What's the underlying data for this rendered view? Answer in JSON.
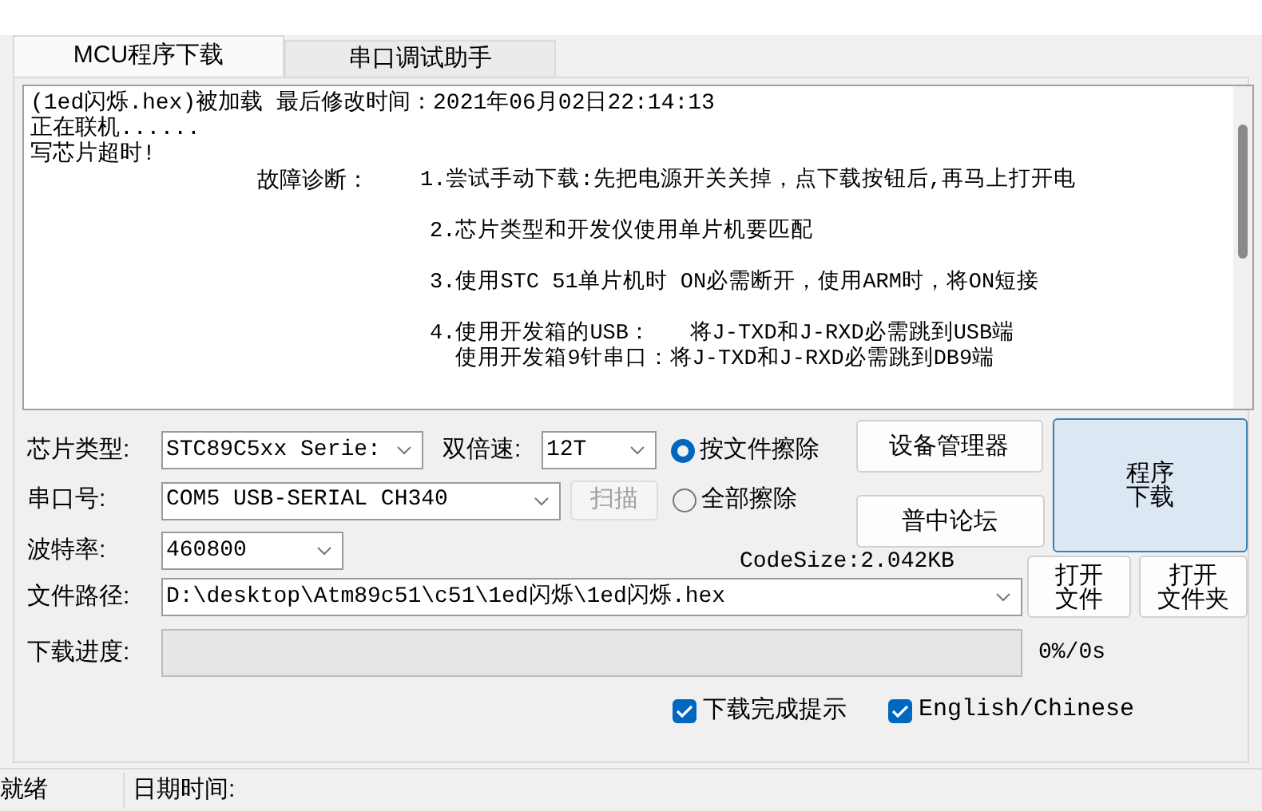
{
  "tabs": [
    {
      "label": "MCU程序下载",
      "selected": true
    },
    {
      "label": "串口调试助手",
      "selected": false
    }
  ],
  "log": {
    "lines": [
      "(1ed闪烁.hex)被加载 最后修改时间：2021年06月02日22:14:13",
      "正在联机......",
      "写芯片超时!"
    ],
    "diagnosis": {
      "label": "故障诊断：",
      "items": [
        [
          "1.尝试手动下载:先把电源开关关掉，点下载按钮后,再马上打开电"
        ],
        [
          "2.芯片类型和开发仪使用单片机要匹配"
        ],
        [
          "3.使用STC 51单片机时 ON必需断开，使用ARM时，将ON短接"
        ],
        [
          "4.使用开发箱的USB：   将J-TXD和J-RXD必需跳到USB端",
          "  使用开发箱9针串口：将J-TXD和J-RXD必需跳到DB9端"
        ]
      ]
    }
  },
  "chip_type": {
    "label": "芯片类型:",
    "value": "STC89C5xx Serie:"
  },
  "double_speed": {
    "label": "双倍速:",
    "value": "12T"
  },
  "erase_options": [
    {
      "label": "按文件擦除",
      "selected": true
    },
    {
      "label": "全部擦除",
      "selected": false
    }
  ],
  "device_manager_button": "设备管理器",
  "forum_button": "普中论坛",
  "download_button": [
    "程序",
    "下载"
  ],
  "port": {
    "label": "串口号:",
    "value": "COM5  USB-SERIAL CH340"
  },
  "scan_button": {
    "label": "扫描",
    "disabled": true
  },
  "baud": {
    "label": "波特率:",
    "value": "460800"
  },
  "code_size": "CodeSize:2.042KB",
  "file_path": {
    "label": "文件路径:",
    "value": "D:\\desktop\\Atm89c51\\c51\\1ed闪烁\\1ed闪烁.hex"
  },
  "open_file_button": [
    "打开",
    "文件"
  ],
  "open_folder_button": [
    "打开",
    "文件夹"
  ],
  "progress": {
    "label": "下载进度:",
    "level": 0,
    "reading": "0%/0s"
  },
  "checkboxes": [
    {
      "label": "下载完成提示",
      "checked": true
    },
    {
      "label": "English/Chinese",
      "checked": true
    }
  ],
  "status_bar": [
    "就绪",
    "日期时间:"
  ]
}
